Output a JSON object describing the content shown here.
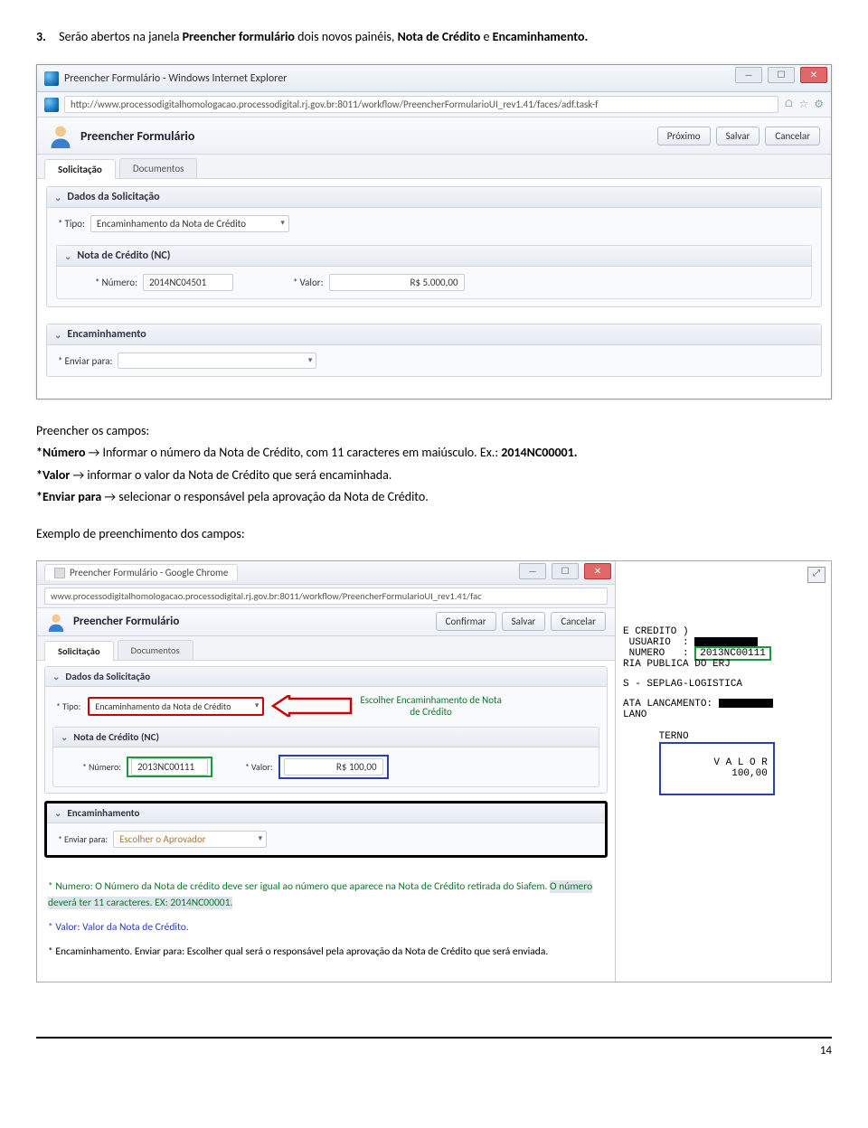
{
  "intro": {
    "num": "3.",
    "before": "Serão abertos na janela ",
    "b1": "Preencher formulário",
    "mid": " dois novos painéis, ",
    "b2": "Nota de Crédito",
    "sep": " e ",
    "b3": "Encaminhamento.",
    "after": ""
  },
  "shot1": {
    "window_title": "Preencher Formulário - Windows Internet Explorer",
    "url": "http://www.processodigitalhomologacao.processodigital.rj.gov.br:8011/workflow/PreencherFormularioUI_rev1.41/faces/adf.task-f",
    "app_title": "Preencher Formulário",
    "btns": {
      "proximo": "Próximo",
      "salvar": "Salvar",
      "cancelar": "Cancelar"
    },
    "tabs": {
      "solicitacao": "Solicitação",
      "documentos": "Documentos"
    },
    "panel_dados": "Dados da Solicitação",
    "tipo_label": "Tipo:",
    "tipo_value": "Encaminhamento da Nota de Crédito",
    "panel_nc": "Nota de Crédito (NC)",
    "numero_label": "Número:",
    "numero_value": "2014NC04501",
    "valor_label": "Valor:",
    "valor_value": "R$ 5.000,00",
    "panel_enc": "Encaminhamento",
    "enviar_label": "Enviar para:"
  },
  "body": {
    "l0": "Preencher os campos:",
    "l1a": "*Número",
    "l1b": " → Informar o número da Nota de Crédito, com 11 caracteres em maiúsculo. Ex.: ",
    "l1c": "2014NC00001.",
    "l2a": "*Valor",
    "l2b": " → informar o valor da Nota de Crédito que será encaminhada.",
    "l3a": "*Enviar para",
    "l3b": " → selecionar o responsável pela aprovação da Nota de Crédito.",
    "l4": "Exemplo de preenchimento dos campos:"
  },
  "shot2": {
    "chrome_title": "Preencher Formulário - Google Chrome",
    "url": "www.processodigitalhomologacao.processodigital.rj.gov.br:8011/workflow/PreencherFormularioUI_rev1.41/fac",
    "app_title": "Preencher Formulário",
    "btns": {
      "confirmar": "Confirmar",
      "salvar": "Salvar",
      "cancelar": "Cancelar"
    },
    "tabs": {
      "solicitacao": "Solicitação",
      "documentos": "Documentos"
    },
    "panel_dados": "Dados da Solicitação",
    "tipo_label": "Tipo:",
    "tipo_value": "Encaminhamento da Nota de Crédito",
    "note_escolher_l1": "Escolher Encaminhamento de Nota",
    "note_escolher_l2": "de Crédito",
    "panel_nc": "Nota de Crédito (NC)",
    "numero_label": "Número:",
    "numero_value": "2013NC00111",
    "valor_label": "Valor:",
    "valor_value": "R$ 100,00",
    "panel_enc": "Encaminhamento",
    "enviar_label": "Enviar para:",
    "enviar_value": "Escolher o Aprovador",
    "notes": {
      "n1a": "* Numero: O Número da Nota de crédito deve ser igual ao número que aparece na Nota de Crédito retirada do Siafem. ",
      "n1b": "O número deverá ter 11 caracteres. EX: 2014NC00001.",
      "n2": "* Valor: Valor da Nota de Crédito.",
      "n3": "* Encaminhamento. Enviar para: Escolher qual será o responsável pela aprovação da Nota de Crédito que será enviada."
    },
    "right": {
      "l1": "E CREDITO )",
      "l2": " USUARIO  :",
      "l3a": " NUMERO   :",
      "l3b": "2013NC00111",
      "l4": "RIA PUBLICA DO ERJ",
      "l5": "S - SEPLAG-LOGISTICA",
      "l6": "ATA LANCAMENTO:",
      "l7": "LANO",
      "l8": "TERNO",
      "valor_lbl": "V A L O R",
      "valor_val": "100,00"
    }
  },
  "page_num": "14"
}
